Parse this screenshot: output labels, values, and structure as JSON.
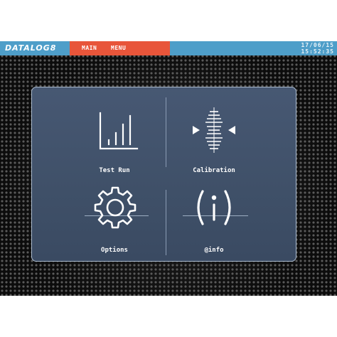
{
  "topbar": {
    "logo": "DATALOG8",
    "menu": [
      "MAIN",
      "MENU"
    ],
    "date": "17/06/15",
    "time": "15:52:35"
  },
  "tiles": [
    {
      "label": "Test Run",
      "icon": "bar-chart-icon"
    },
    {
      "label": "Calibration",
      "icon": "calibration-icon"
    },
    {
      "label": "Options",
      "icon": "gear-icon"
    },
    {
      "label": "@info",
      "icon": "info-icon"
    }
  ],
  "colors": {
    "topbar_blue": "#4e9ec9",
    "topbar_orange": "#e8553a",
    "panel": "#43546e",
    "icon_white": "#ffffff"
  }
}
